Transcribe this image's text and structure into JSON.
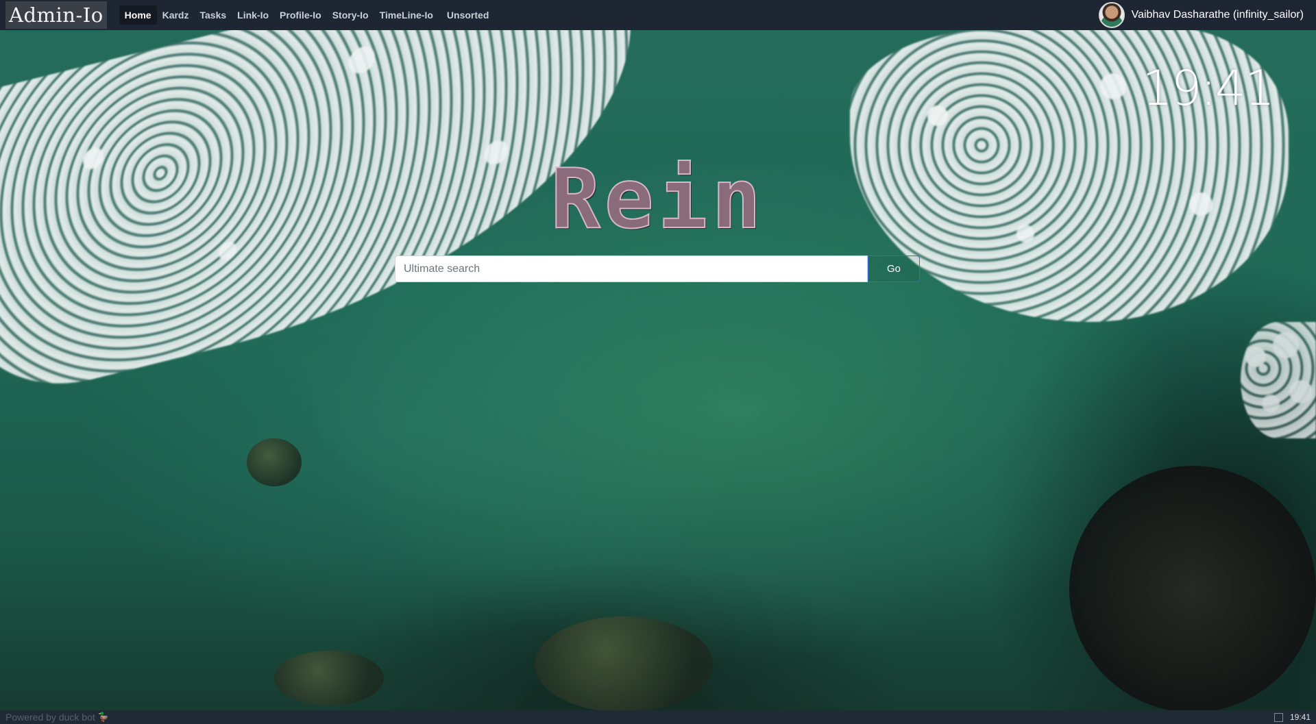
{
  "navbar": {
    "brand": "Admin-Io",
    "links": [
      {
        "label": "Home",
        "active": true
      },
      {
        "label": "Kardz",
        "active": false
      },
      {
        "label": "Tasks",
        "active": false
      },
      {
        "label": "Link-Io",
        "active": false
      },
      {
        "label": "Profile-Io",
        "active": false
      },
      {
        "label": "Story-Io",
        "active": false
      },
      {
        "label": "TimeLine-Io",
        "active": false
      },
      {
        "label": "Unsorted",
        "active": false
      }
    ],
    "user": {
      "name": "Vaibhav Dasharathe (infinity_sailor)"
    }
  },
  "clock": {
    "time": "19:41"
  },
  "hero": {
    "title": "Rein",
    "search_placeholder": "Ultimate search",
    "search_value": "",
    "go_label": "Go"
  },
  "footer": {
    "powered_by": "Powered by duck bot",
    "time": "19:41"
  },
  "colors": {
    "navbar_bg": "#1f2633",
    "footer_bg": "#1f2a36",
    "go_border": "#2f6fd0"
  }
}
